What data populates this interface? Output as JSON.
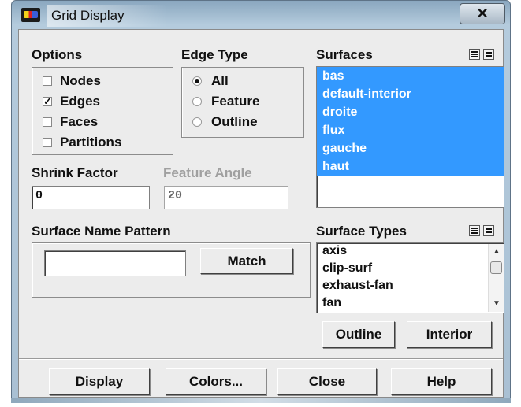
{
  "window": {
    "title": "Grid Display",
    "close_glyph": "✕"
  },
  "options": {
    "label": "Options",
    "items": [
      {
        "label": "Nodes",
        "checked": false
      },
      {
        "label": "Edges",
        "checked": true
      },
      {
        "label": "Faces",
        "checked": false
      },
      {
        "label": "Partitions",
        "checked": false
      }
    ]
  },
  "edge_type": {
    "label": "Edge Type",
    "items": [
      {
        "label": "All",
        "selected": true
      },
      {
        "label": "Feature",
        "selected": false
      },
      {
        "label": "Outline",
        "selected": false
      }
    ]
  },
  "shrink_factor": {
    "label": "Shrink Factor",
    "value": "0"
  },
  "feature_angle": {
    "label": "Feature Angle",
    "value": "20"
  },
  "surfaces": {
    "label": "Surfaces",
    "items": [
      "bas",
      "default-interior",
      "droite",
      "flux",
      "gauche",
      "haut"
    ]
  },
  "surface_name_pattern": {
    "label": "Surface Name Pattern",
    "value": "",
    "match_label": "Match"
  },
  "surface_types": {
    "label": "Surface Types",
    "items": [
      "axis",
      "clip-surf",
      "exhaust-fan",
      "fan"
    ],
    "outline_label": "Outline",
    "interior_label": "Interior"
  },
  "footer": {
    "display": "Display",
    "colors": "Colors...",
    "close": "Close",
    "help": "Help"
  },
  "colors": {
    "selection": "#3399ff",
    "dialog_bg": "#ececec"
  },
  "icons": {
    "app": "fluent-app-icon",
    "select_all": "select-all-icon",
    "deselect_all": "deselect-all-icon"
  }
}
